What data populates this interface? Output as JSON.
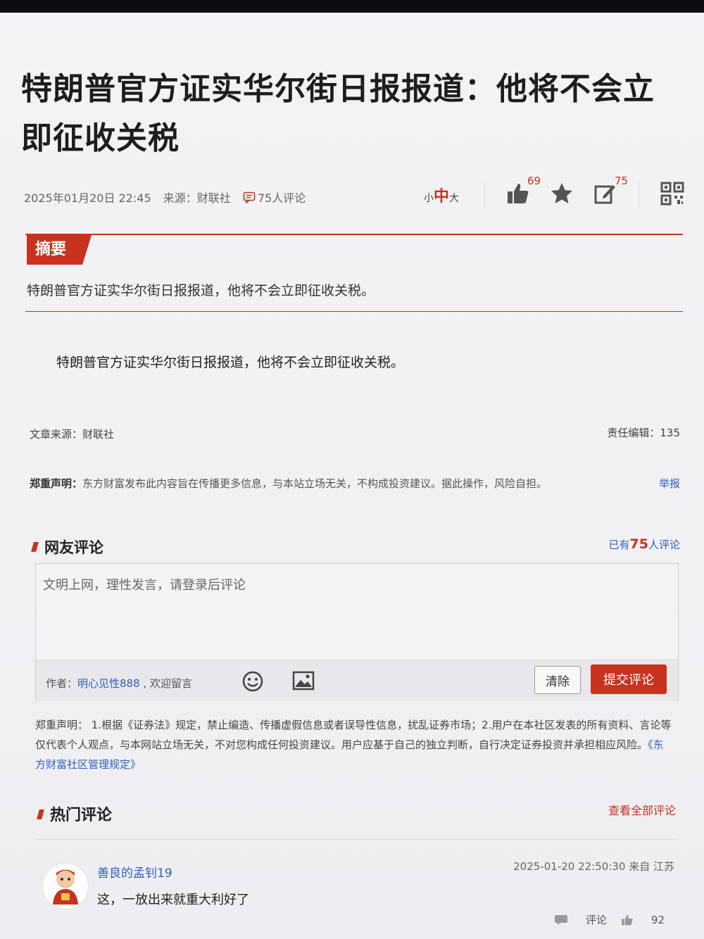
{
  "article": {
    "title": "特朗普官方证实华尔街日报报道：他将不会立即征收关税",
    "date": "2025年01月20日 22:45",
    "source_meta": "来源：财联社",
    "comments_meta": "75人评论"
  },
  "toolbar": {
    "font_small": "小",
    "font_medium": "中",
    "font_large": "大",
    "like_count": "69",
    "edit_count": "75"
  },
  "summary": {
    "tag": "摘要",
    "text": "特朗普官方证实华尔街日报报道，他将不会立即征收关税。"
  },
  "body": {
    "paragraph": "特朗普官方证实华尔街日报报道，他将不会立即征收关税。"
  },
  "footer": {
    "source": "文章来源：财联社",
    "editor": "责任编辑：135",
    "disclaimer_label": "郑重声明：",
    "disclaimer_text": "东方财富发布此内容旨在传播更多信息，与本站立场无关，不构成投资建议。据此操作，风险自担。",
    "report": "举报"
  },
  "comments": {
    "heading": "网友评论",
    "already_prefix": "已有",
    "already_count": "75",
    "already_suffix": "人评论",
    "placeholder": "文明上网，理性发言，请登录后评论",
    "author_label": "作者：",
    "author_name": "明心见性888",
    "author_suffix": " , 欢迎留言",
    "clear_label": "清除",
    "submit_label": "提交评论"
  },
  "legal": {
    "text": "郑重声明：  1.根据《证券法》规定，禁止编造、传播虚假信息或者误导性信息，扰乱证券市场；2.用户在本社区发表的所有资料、言论等仅代表个人观点，与本网站立场无关，不对您构成任何投资建议。用户应基于自己的独立判断，自行决定证券投资并承担相应风险。",
    "link": "《东方财富社区管理规定》"
  },
  "hot": {
    "heading": "热门评论",
    "view_all": "查看全部评论",
    "items": [
      {
        "user": "善良的孟钊19",
        "time": "2025-01-20 22:50:30 来自 江苏",
        "text": "这，一放出来就重大利好了",
        "reply_label": "评论",
        "likes": "92"
      }
    ]
  },
  "colors": {
    "accent": "#c8321e",
    "link": "#2f5fb8"
  }
}
